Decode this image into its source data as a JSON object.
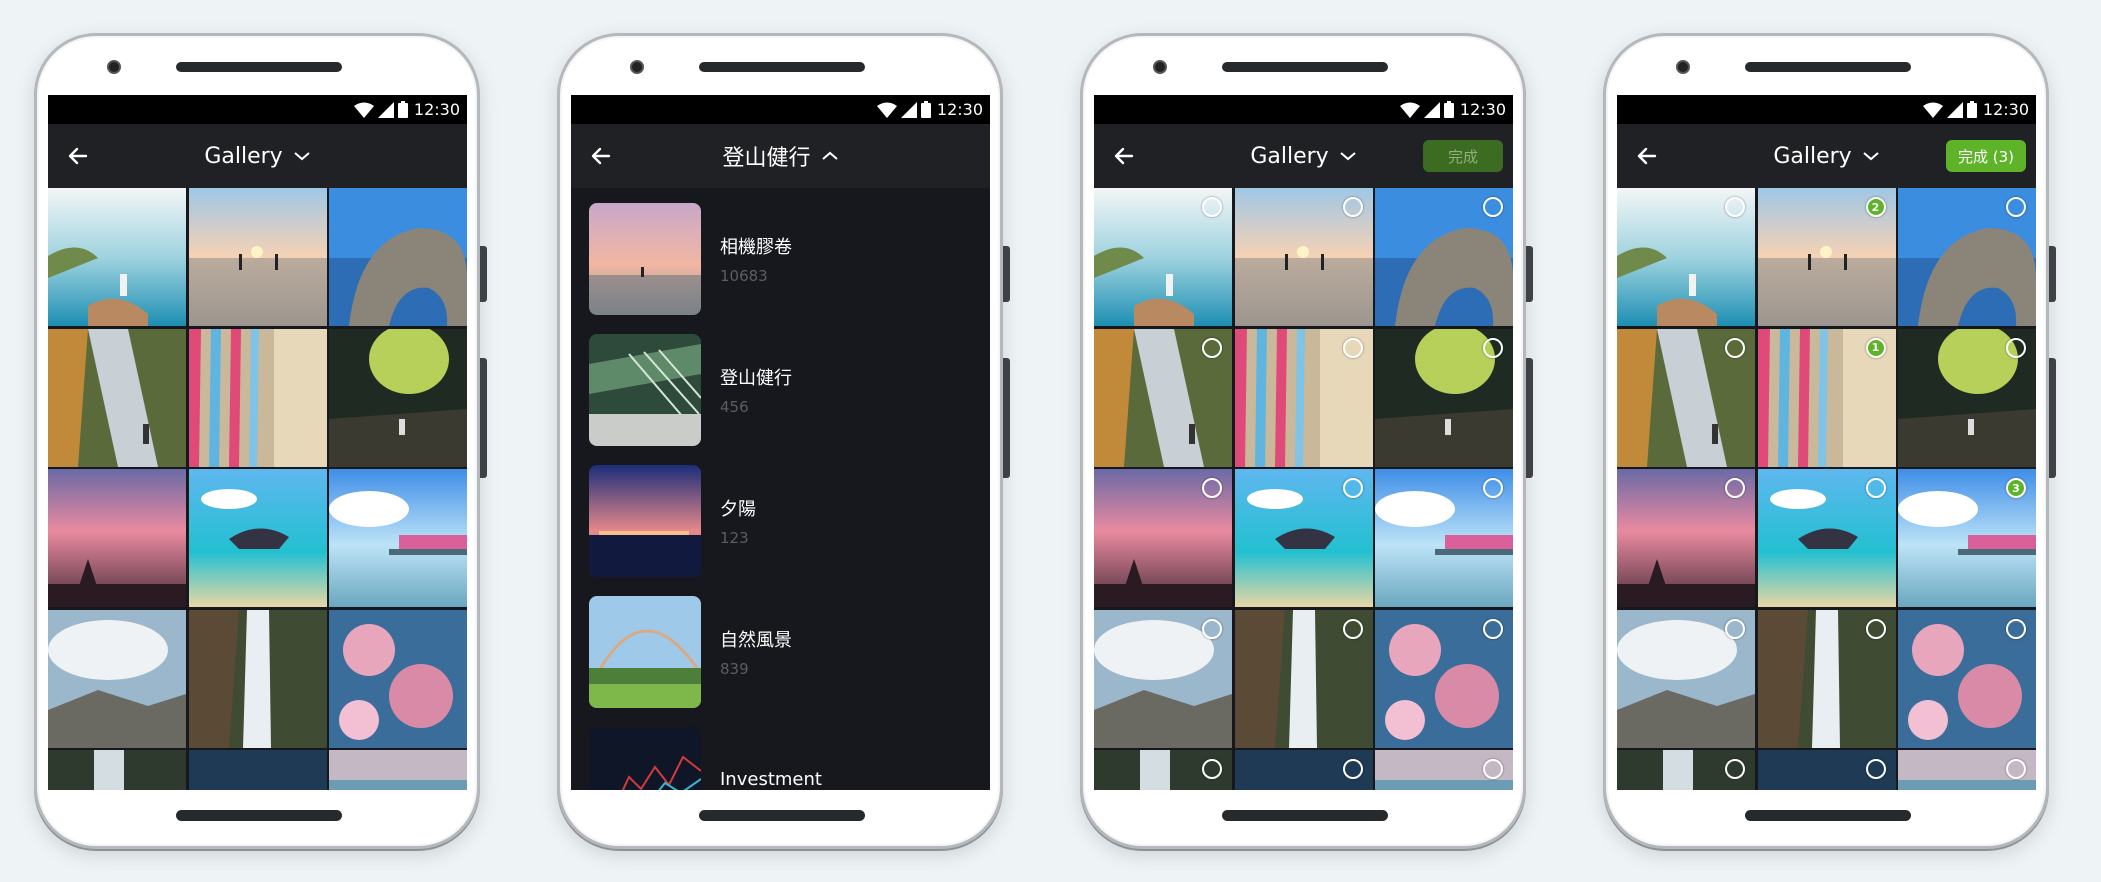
{
  "status_time": "12:30",
  "phones": [
    {
      "title": "Gallery",
      "dropdown": "down",
      "done": null
    },
    {
      "title": "登山健行",
      "dropdown": "up",
      "done": null
    },
    {
      "title": "Gallery",
      "dropdown": "down",
      "done": "完成"
    },
    {
      "title": "Gallery",
      "dropdown": "down",
      "done": "完成 (3)"
    }
  ],
  "albums": [
    {
      "name": "相機膠卷",
      "count": "10683"
    },
    {
      "name": "登山健行",
      "count": "456"
    },
    {
      "name": "夕陽",
      "count": "123"
    },
    {
      "name": "自然風景",
      "count": "839"
    },
    {
      "name": "Investment",
      "count": ""
    }
  ],
  "selection_badges": {
    "4": "1",
    "1": "2",
    "8": "3"
  },
  "colors": {
    "accent": "#5fb329",
    "accent_disabled": "#3c6b22",
    "appbar": "#202124",
    "screen_bg": "#16181e"
  },
  "icons": [
    "wifi-icon",
    "signal-icon",
    "battery-icon",
    "back-arrow-icon",
    "chevron-down-icon",
    "chevron-up-icon",
    "select-circle-icon"
  ]
}
